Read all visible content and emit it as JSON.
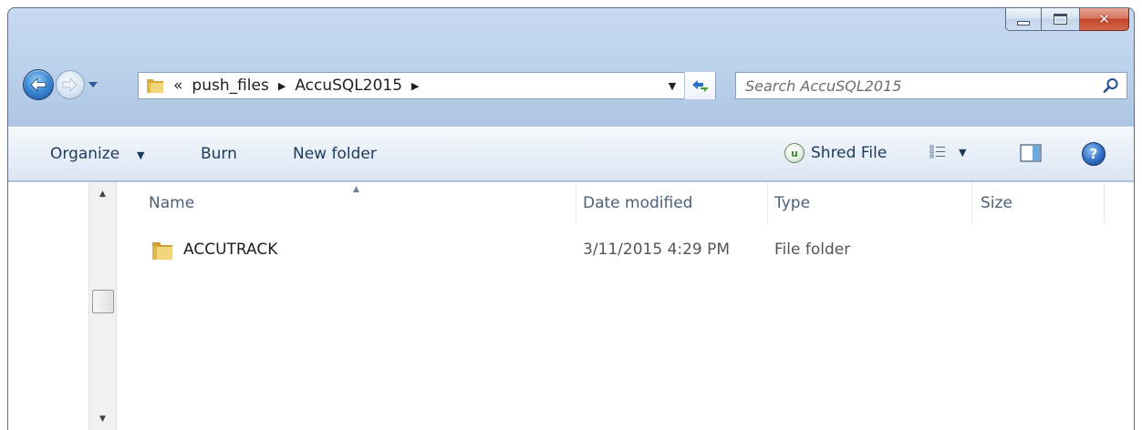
{
  "window": {
    "caption_close": "✕"
  },
  "navigation": {
    "breadcrumb_overflow": "«",
    "breadcrumbs": [
      "push_files",
      "AccuSQL2015"
    ],
    "search_placeholder": "Search AccuSQL2015"
  },
  "toolbar": {
    "organize_label": "Organize",
    "burn_label": "Burn",
    "new_folder_label": "New folder",
    "shred_label": "Shred File",
    "shred_icon_letter": "u",
    "help_label": "?"
  },
  "columns": {
    "name": "Name",
    "date_modified": "Date modified",
    "type": "Type",
    "size": "Size"
  },
  "files": [
    {
      "name": "ACCUTRACK",
      "date_modified": "3/11/2015 4:29 PM",
      "type": "File folder",
      "size": ""
    }
  ],
  "colors": {
    "chrome_blue": "#bcd2ec",
    "command_text": "#1e395b",
    "header_text": "#4c607a",
    "close_red": "#c2472b",
    "folder_yellow": "#e8c25a"
  },
  "icons": {
    "back": "back-arrow-icon",
    "forward": "forward-arrow-icon",
    "folder": "folder-icon",
    "refresh": "refresh-icon",
    "search": "search-icon",
    "shred": "shred-icon",
    "views": "views-icon",
    "preview": "preview-pane-icon",
    "help": "help-icon"
  }
}
